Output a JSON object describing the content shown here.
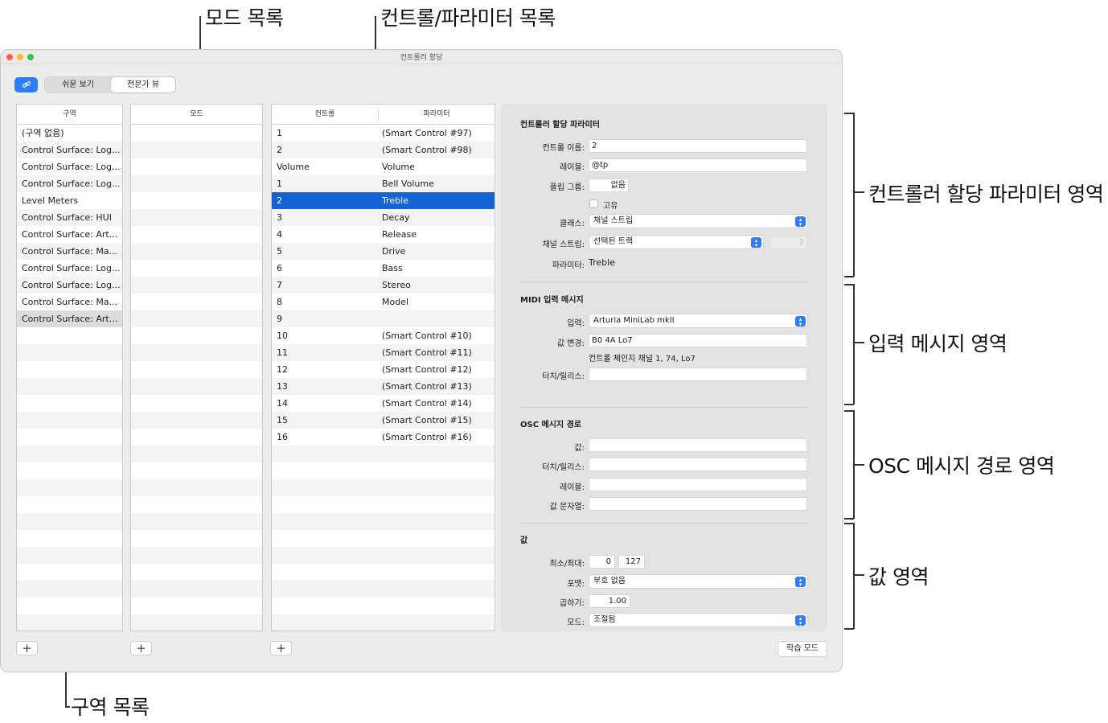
{
  "callouts": {
    "mode_list": "모드 목록",
    "control_param_list": "컨트롤/파라미터 목록",
    "zone_list": "구역 목록",
    "controller_assign_area": "컨트롤러 할당 파라미터 영역",
    "input_message_area": "입력 메시지 영역",
    "osc_path_area": "OSC 메시지 경로 영역",
    "value_area": "값 영역"
  },
  "window": {
    "title": "컨트롤러 할당",
    "traffic_lights": {
      "close": "#fe5f57",
      "minimize": "#febc2e",
      "zoom": "#28c840"
    }
  },
  "toolbar": {
    "link_icon": "link-icon",
    "simple_view": "쉬운 보기",
    "expert_view": "전문가 뷰",
    "active_view": "expert"
  },
  "zones": {
    "header": "구역",
    "items": [
      "(구역 없음)",
      "Control Surface: Log...",
      "Control Surface: Log...",
      "Control Surface: Log...",
      "Level Meters",
      "Control Surface: HUI",
      "Control Surface: Art...",
      "Control Surface: Ma...",
      "Control Surface: Log...",
      "Control Surface: Log...",
      "Control Surface: Ma...",
      "Control Surface: Art..."
    ],
    "selected_index": 11
  },
  "modes": {
    "header": "모드",
    "items": []
  },
  "controls": {
    "header_control": "컨트롤",
    "header_param": "파라미터",
    "rows": [
      {
        "control": "1",
        "param": "(Smart Control #97)"
      },
      {
        "control": "2",
        "param": "(Smart Control #98)"
      },
      {
        "control": "Volume",
        "param": "Volume"
      },
      {
        "control": "1",
        "param": "Bell Volume"
      },
      {
        "control": "2",
        "param": "Treble"
      },
      {
        "control": "3",
        "param": "Decay"
      },
      {
        "control": "4",
        "param": "Release"
      },
      {
        "control": "5",
        "param": "Drive"
      },
      {
        "control": "6",
        "param": "Bass"
      },
      {
        "control": "7",
        "param": "Stereo"
      },
      {
        "control": "8",
        "param": "Model"
      },
      {
        "control": "9",
        "param": ""
      },
      {
        "control": "10",
        "param": "(Smart Control #10)"
      },
      {
        "control": "11",
        "param": "(Smart Control #11)"
      },
      {
        "control": "12",
        "param": "(Smart Control #12)"
      },
      {
        "control": "13",
        "param": "(Smart Control #13)"
      },
      {
        "control": "14",
        "param": "(Smart Control #14)"
      },
      {
        "control": "15",
        "param": "(Smart Control #15)"
      },
      {
        "control": "16",
        "param": "(Smart Control #16)"
      }
    ],
    "selected_index": 4
  },
  "add_button": "+",
  "learn_mode": "학습 모드",
  "inspector": {
    "assign": {
      "title": "컨트롤러 할당 파라미터",
      "control_name_label": "컨트롤 이름:",
      "control_name_value": "2",
      "label_label": "레이블:",
      "label_value": "@tp",
      "flip_group_label": "플립 그룹:",
      "flip_group_value": "없음",
      "exclusive_label": "고유",
      "exclusive_checked": false,
      "class_label": "클래스:",
      "class_value": "채널 스트립",
      "channel_strip_label": "채널 스트립:",
      "channel_strip_value": "선택된 트랙",
      "channel_strip_number": "1",
      "parameter_label": "파라미터:",
      "parameter_value": "Treble"
    },
    "midi": {
      "title": "MIDI 입력 메시지",
      "input_label": "입력:",
      "input_value": "Arturia MiniLab mkII",
      "value_change_label": "값 변경:",
      "value_change_value": "B0 4A Lo7",
      "value_change_desc": "컨트롤 체인지 채널 1, 74, Lo7",
      "touch_release_label": "터치/릴리스:",
      "touch_release_value": ""
    },
    "osc": {
      "title": "OSC 메시지 경로",
      "value_label": "값:",
      "touch_release_label": "터치/릴리스:",
      "label_label": "레이블:",
      "value_string_label": "값 문자열:"
    },
    "value": {
      "title": "값",
      "minmax_label": "최소/최대:",
      "min": "0",
      "max": "127",
      "format_label": "포맷:",
      "format_value": "부호 없음",
      "multiply_label": "곱하기:",
      "multiply_value": "1.00",
      "mode_label": "모드:",
      "mode_value": "조절됨"
    }
  },
  "colors": {
    "accent": "#2e7cf6",
    "selection": "#1463d6",
    "window_bg": "#ececec",
    "inspector_bg": "#e3e3e3"
  }
}
